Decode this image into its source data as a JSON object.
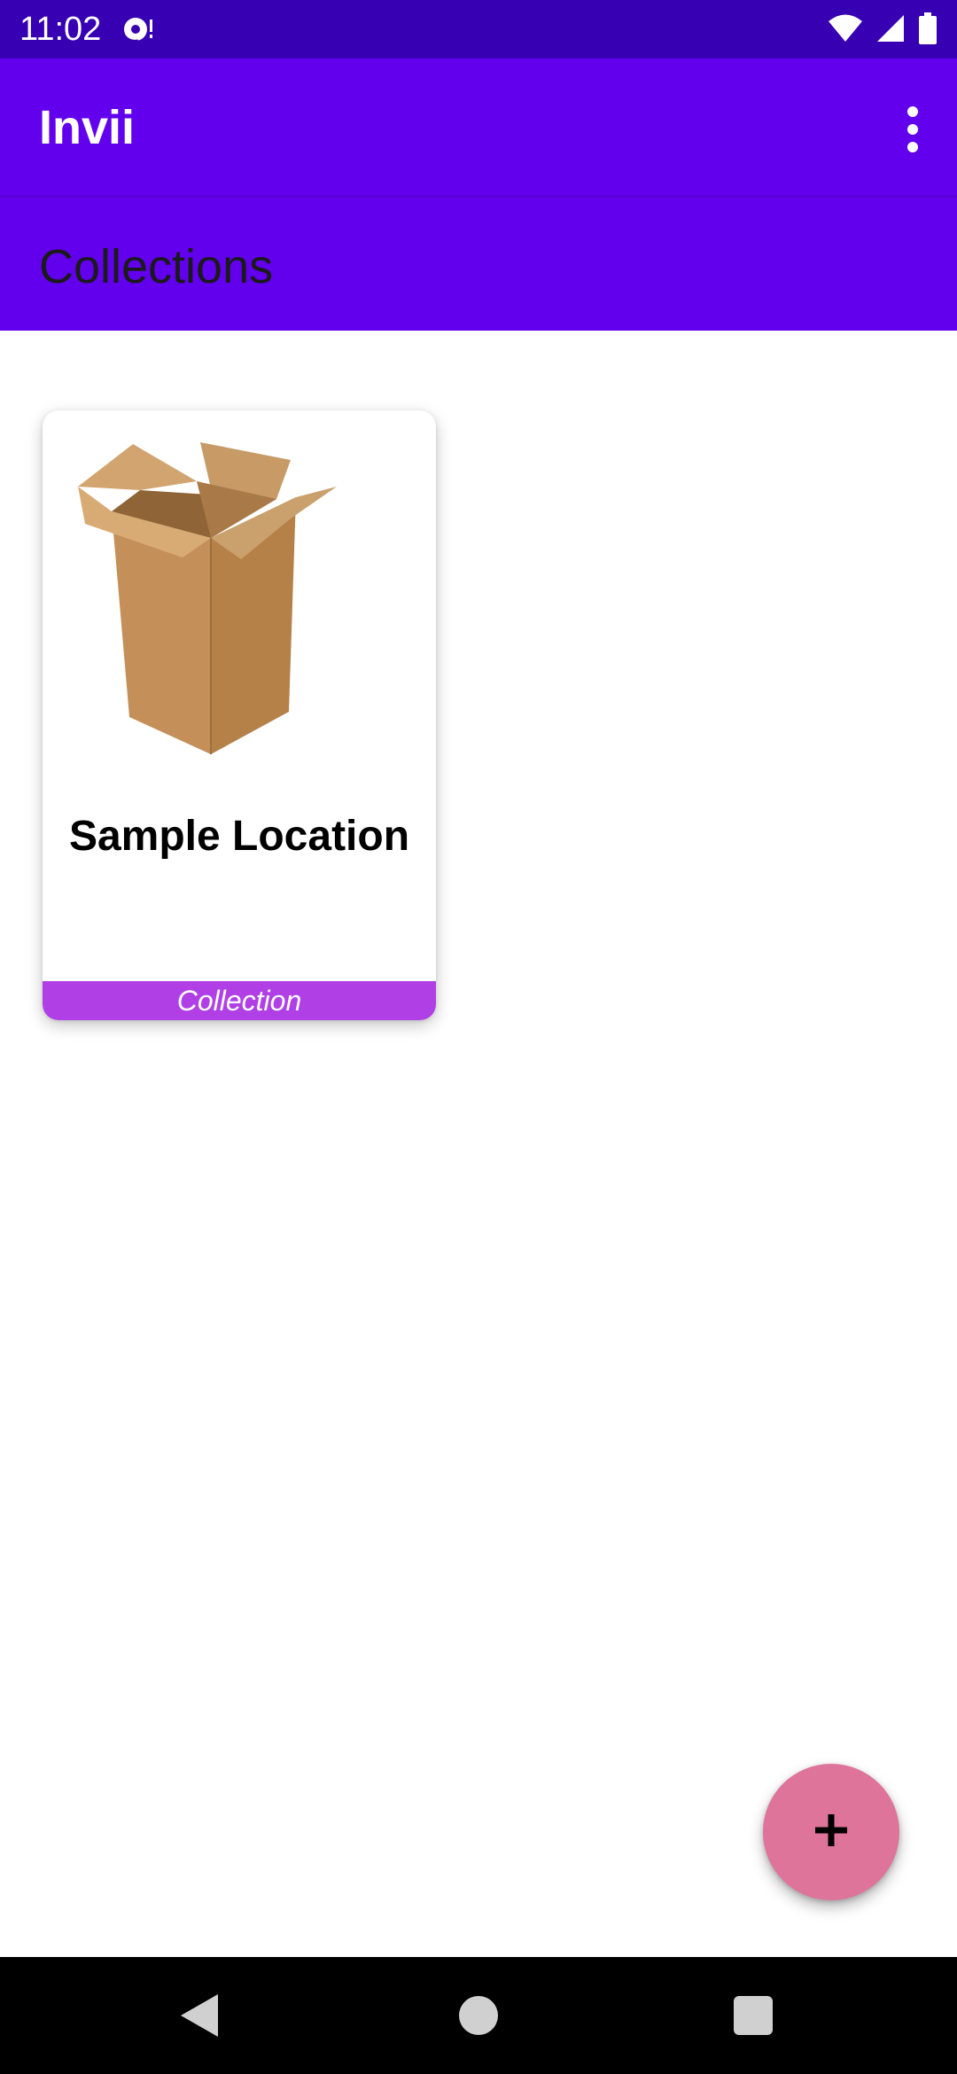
{
  "status_bar": {
    "time": "11:02",
    "icons": [
      "sync-icon",
      "wifi-icon",
      "signal-icon",
      "battery-icon"
    ]
  },
  "app_bar": {
    "title": "Invii",
    "menu_icon": "more-vert-icon"
  },
  "section": {
    "title": "Collections"
  },
  "collections": [
    {
      "title": "Sample Location",
      "type_label": "Collection",
      "image": "cardboard-box-image"
    }
  ],
  "fab": {
    "icon": "plus-icon"
  },
  "nav_bar": {
    "icons": [
      "back-icon",
      "home-icon",
      "recents-icon"
    ]
  },
  "colors": {
    "status_bar": "#3700b3",
    "primary": "#6200ee",
    "card_footer": "#b03fe6",
    "fab": "#de7499"
  }
}
